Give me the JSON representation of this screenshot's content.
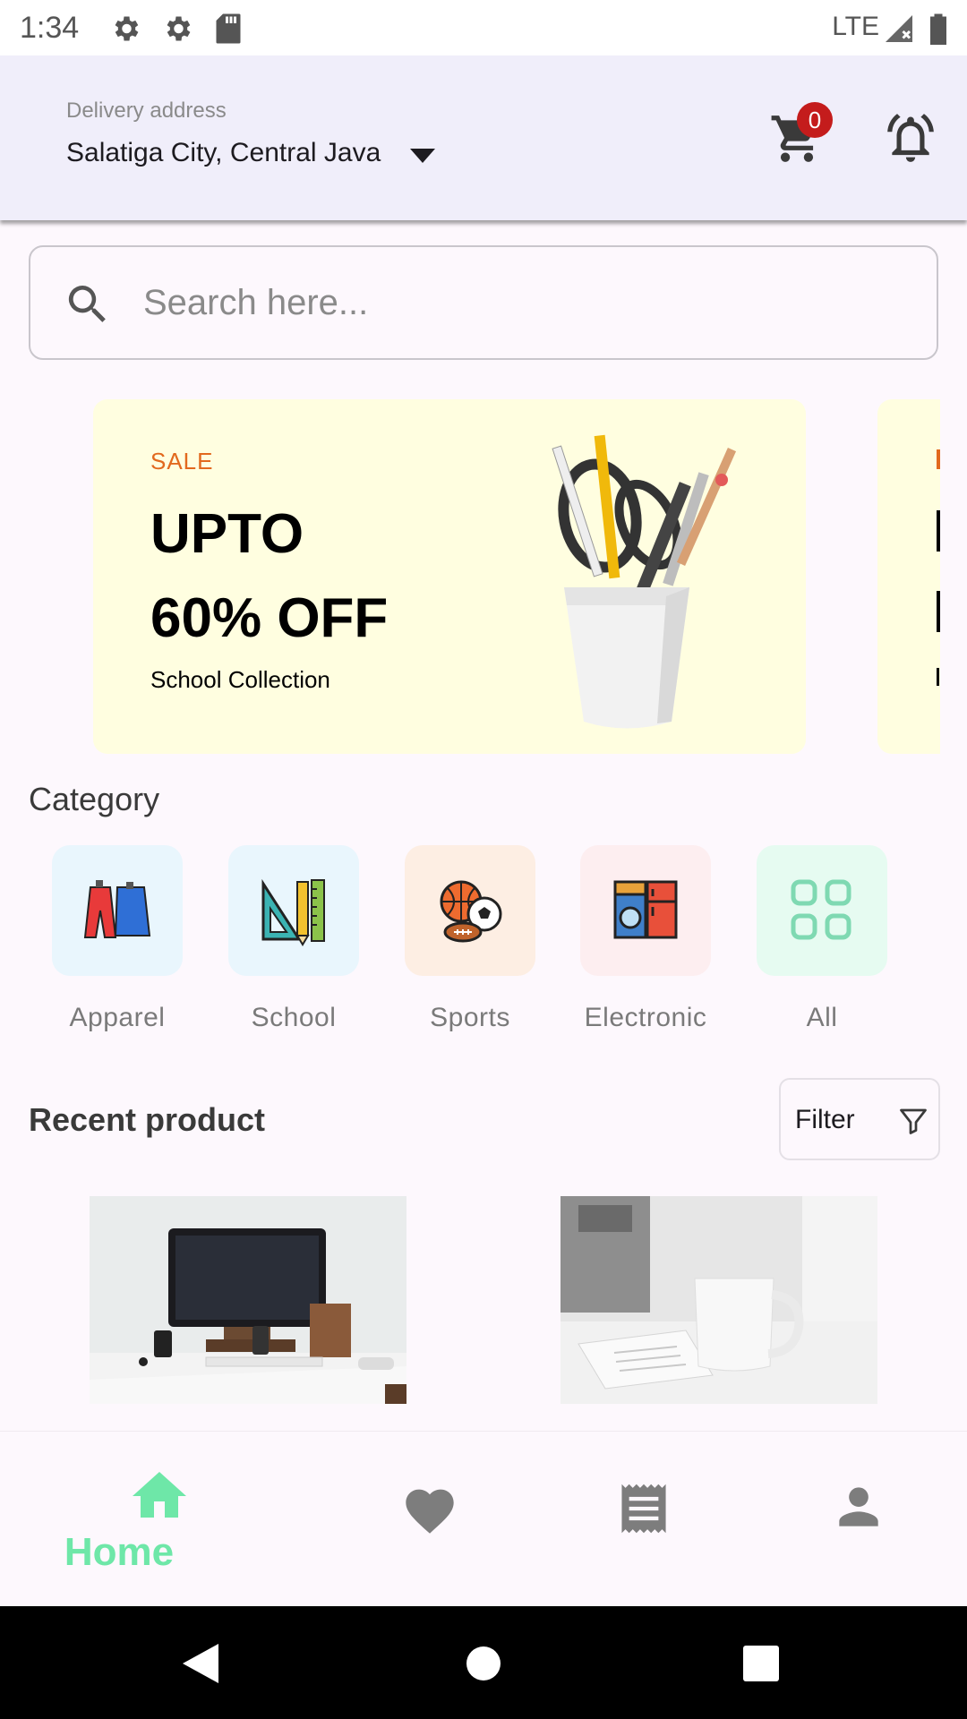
{
  "status_bar": {
    "time": "1:34",
    "network": "LTE"
  },
  "header": {
    "delivery_label": "Delivery address",
    "delivery_address": "Salatiga City, Central Java",
    "cart_count": "0"
  },
  "search": {
    "placeholder": "Search here..."
  },
  "banner": {
    "tag": "SALE",
    "headline_line1": "UPTO",
    "headline_line2": "60% OFF",
    "subtitle": "School Collection"
  },
  "category": {
    "title": "Category",
    "items": [
      {
        "label": "Apparel",
        "icon": "apparel-icon",
        "tile_color": "#e9f6fd"
      },
      {
        "label": "School",
        "icon": "school-supplies-icon",
        "tile_color": "#e9f6fd"
      },
      {
        "label": "Sports",
        "icon": "sports-balls-icon",
        "tile_color": "#fdeee3"
      },
      {
        "label": "Electronic",
        "icon": "appliances-icon",
        "tile_color": "#fdeef0"
      },
      {
        "label": "All",
        "icon": "grid-icon",
        "tile_color": "#e6fbf1"
      }
    ]
  },
  "recent": {
    "title": "Recent product",
    "filter_label": "Filter"
  },
  "bottom_nav": {
    "items": [
      {
        "label": "Home",
        "icon": "home-icon",
        "active": true
      },
      {
        "label": "",
        "icon": "heart-icon",
        "active": false
      },
      {
        "label": "",
        "icon": "receipt-icon",
        "active": false
      },
      {
        "label": "",
        "icon": "person-icon",
        "active": false
      }
    ],
    "active_color": "#6ee7a8",
    "inactive_color": "#7d7d7d"
  }
}
